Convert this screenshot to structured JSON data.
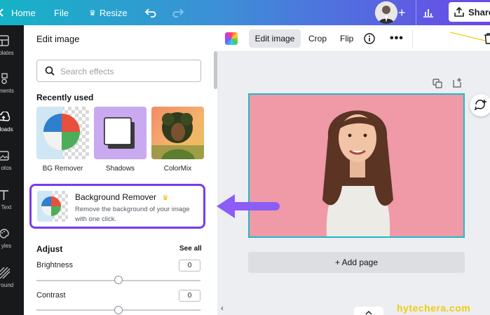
{
  "topbar": {
    "home_label": "Home",
    "file_label": "File",
    "resize_label": "Resize",
    "share_label": "Share"
  },
  "rail": {
    "items": [
      {
        "label": "plates",
        "icon": "templates-icon"
      },
      {
        "label": "ments",
        "icon": "elements-icon"
      },
      {
        "label": "loads",
        "icon": "uploads-icon"
      },
      {
        "label": "otos",
        "icon": "photos-icon"
      },
      {
        "label": "Text",
        "icon": "text-icon"
      },
      {
        "label": "yles",
        "icon": "styles-icon"
      },
      {
        "label": "round",
        "icon": "background-icon"
      }
    ]
  },
  "panel": {
    "title": "Edit image",
    "search_placeholder": "Search effects",
    "recently_used_heading": "Recently used",
    "recent": [
      {
        "label": "BG Remover"
      },
      {
        "label": "Shadows"
      },
      {
        "label": "ColorMix"
      }
    ],
    "feature": {
      "title": "Background Remover",
      "description": "Remove the background of your image with one click."
    },
    "adjust": {
      "heading": "Adjust",
      "see_all": "See all",
      "controls": [
        {
          "label": "Brightness",
          "value": "0"
        },
        {
          "label": "Contrast",
          "value": "0"
        }
      ]
    }
  },
  "context_toolbar": {
    "edit_image_label": "Edit image",
    "crop_label": "Crop",
    "flip_label": "Flip"
  },
  "canvas": {
    "add_page_label": "+ Add page"
  },
  "watermark": "hytechera.com",
  "colors": {
    "accent_purple": "#7c3aed",
    "selection_teal": "#1fb9c9",
    "canvas_pink": "#ef9aa6"
  }
}
